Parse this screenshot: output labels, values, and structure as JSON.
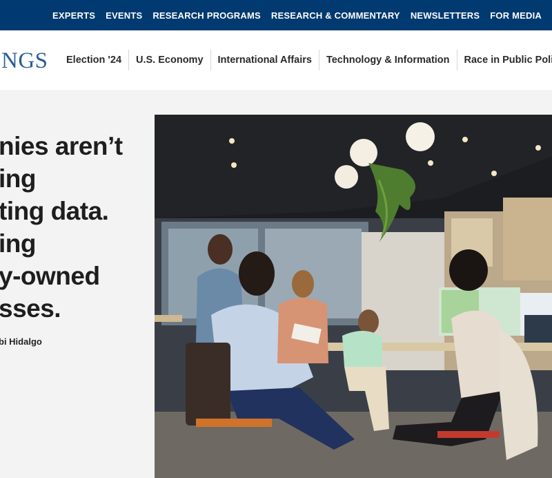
{
  "top_nav": {
    "items": [
      "EXPERTS",
      "EVENTS",
      "RESEARCH PROGRAMS",
      "RESEARCH & COMMENTARY",
      "NEWSLETTERS",
      "FOR MEDIA"
    ]
  },
  "main_bar": {
    "logo_text": "NGS",
    "nav_items": [
      "Election '24",
      "U.S. Economy",
      "International Affairs",
      "Technology & Information",
      "Race in Public Policy"
    ]
  },
  "article": {
    "headline_lines": [
      "nies aren’t",
      "ing",
      "ting data.",
      "ing",
      "y-owned",
      "sses."
    ],
    "byline": "bi Hidalgo"
  },
  "image": {
    "alt_subject": "office-team-meeting-photo"
  }
}
